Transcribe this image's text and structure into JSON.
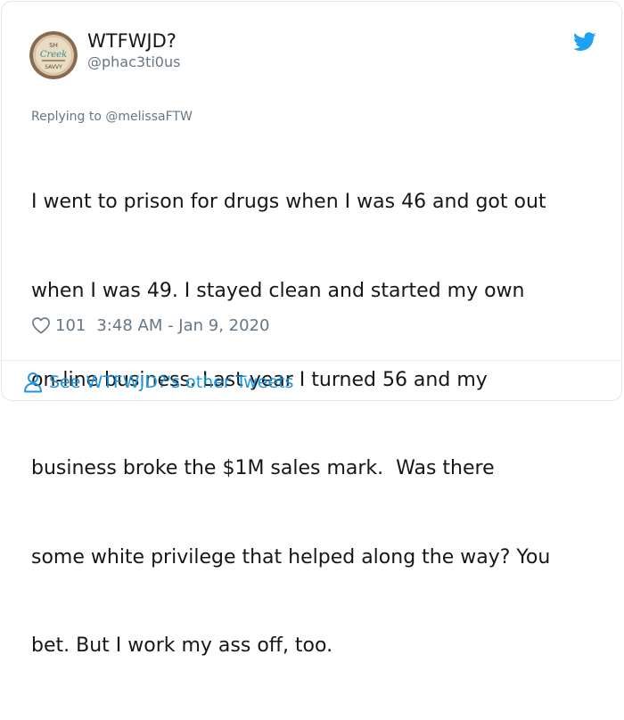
{
  "author": {
    "display_name": "WTFWJD?",
    "handle": "@phac3ti0us",
    "avatar_text_top": "SH",
    "avatar_text_mid": "Creek",
    "avatar_text_bottom": "SAVVY"
  },
  "reply_context": {
    "prefix": "Replying to ",
    "mention": "@melissaFTW"
  },
  "tweet": {
    "lines": [
      "I went to prison for drugs when I was 46 and got out",
      "when I was 49. I stayed clean and started my own",
      "on-line business. Last year I turned 56 and my",
      "business broke the $1M sales mark.  Was there",
      "some white privilege that helped along the way? You",
      "bet. But I work my ass off, too."
    ]
  },
  "meta": {
    "like_count": "101",
    "timestamp": "3:48 AM - Jan 9, 2020"
  },
  "footer": {
    "see_more_label": "See WTFWJD?'s other Tweets"
  },
  "colors": {
    "twitter_blue": "#1da1f2",
    "link_blue": "#1b95e0",
    "secondary_text": "#657786",
    "border": "#e1e8ed"
  },
  "icons": {
    "brand": "twitter-bird-icon",
    "like": "heart-icon",
    "profile": "person-icon"
  }
}
